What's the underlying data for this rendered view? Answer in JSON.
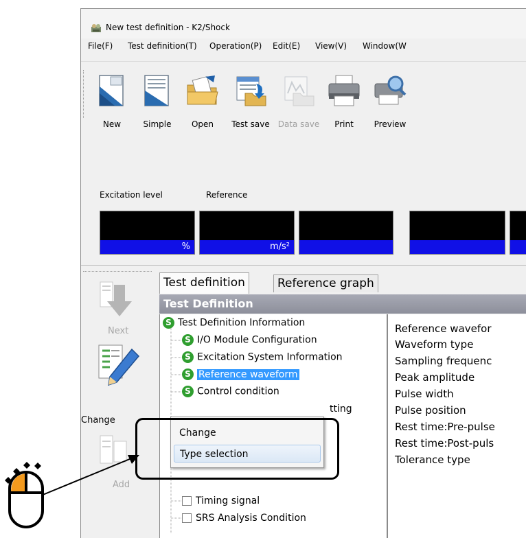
{
  "window": {
    "title": "New test definition - K2/Shock"
  },
  "menu": [
    "File(F)",
    "Test definition(T)",
    "Operation(P)",
    "Edit(E)",
    "View(V)",
    "Window(W"
  ],
  "toolbar": {
    "buttons": [
      {
        "label": "New",
        "icon": "new-document-icon"
      },
      {
        "label": "Simple",
        "icon": "simple-document-icon"
      },
      {
        "label": "Open",
        "icon": "open-folder-icon"
      },
      {
        "label": "Test save",
        "icon": "test-save-icon"
      },
      {
        "label": "Data save",
        "icon": "data-save-icon",
        "disabled": true
      },
      {
        "label": "Print",
        "icon": "printer-icon"
      },
      {
        "label": "Preview",
        "icon": "print-preview-icon"
      }
    ]
  },
  "meters": {
    "excitation_label": "Excitation level",
    "reference_label": "Reference",
    "excitation_unit": "%",
    "reference_unit": "m/s²"
  },
  "side": {
    "next": "Next",
    "change": "Change",
    "add": "Add"
  },
  "tabs": [
    "Test definition",
    "Reference graph"
  ],
  "section_title": "Test Definition",
  "tree": {
    "root": "Test Definition Information",
    "items": [
      "I/O Module Configuration",
      "Excitation System Information",
      "Reference waveform",
      "Control condition"
    ],
    "partial_item_suffix": "tting",
    "unchecked": [
      "Timing signal",
      "SRS Analysis Condition"
    ]
  },
  "properties": [
    "Reference wavefor",
    "Waveform type",
    "Sampling frequenc",
    "Peak amplitude",
    "Pulse width",
    "Pulse position",
    "Rest time:Pre-pulse",
    "Rest time:Post-puls",
    "Tolerance type"
  ],
  "context_menu": {
    "items": [
      "Change",
      "Type selection"
    ],
    "highlighted": "Type selection"
  },
  "colors": {
    "meter_unit_bg": "#1010e6",
    "meter_bg": "#000000",
    "section_bar": "#9a9ca8",
    "tree_selected": "#3399ff",
    "status_s_icon": "#2f9e2f",
    "mouse_highlight": "#f39a1e"
  }
}
